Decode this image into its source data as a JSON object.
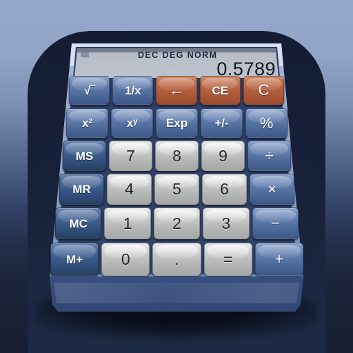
{
  "app": {
    "name": "Calculator",
    "icon_type": "app-icon"
  },
  "colors": {
    "background_top": "#96a8ca",
    "background_bottom": "#171f31",
    "plate": "#17203a",
    "bezel": "#93a6c9",
    "chassis": "#3e5789",
    "key_blue": "#5d79aa",
    "key_blue_dark": "#3d5c8c",
    "key_orange": "#b66243",
    "key_gray": "#c6c7c7",
    "display": "#d9dde1",
    "display_text": "#101722"
  },
  "display": {
    "memory_indicator": "=",
    "mode_indicators": "DEC  DEG    NORM",
    "value": "0.5789"
  },
  "keypad": {
    "rows": [
      {
        "row_index": 0,
        "keys": [
          {
            "name": "sqrt",
            "label": "√‾",
            "style": "blue",
            "glyph_class": ""
          },
          {
            "name": "reciprocal",
            "label": "1/x",
            "style": "blue",
            "glyph_class": ""
          },
          {
            "name": "backspace",
            "label": "←",
            "style": "orange",
            "glyph_class": "big"
          },
          {
            "name": "clear-entry",
            "label": "CE",
            "style": "orange",
            "glyph_class": ""
          },
          {
            "name": "clear",
            "label": "C",
            "style": "orange",
            "glyph_class": "big"
          }
        ]
      },
      {
        "row_index": 1,
        "keys": [
          {
            "name": "square",
            "label": "x²",
            "style": "blue",
            "glyph_class": ""
          },
          {
            "name": "power",
            "label": "xʸ",
            "style": "blue",
            "glyph_class": ""
          },
          {
            "name": "exponent",
            "label": "Exp",
            "style": "blue",
            "glyph_class": ""
          },
          {
            "name": "sign",
            "label": "+/-",
            "style": "blue",
            "glyph_class": ""
          },
          {
            "name": "percent",
            "label": "%",
            "style": "blue",
            "glyph_class": "big"
          }
        ]
      },
      {
        "row_index": 2,
        "keys": [
          {
            "name": "memory-store",
            "label": "MS",
            "style": "blue-dark",
            "glyph_class": ""
          },
          {
            "name": "digit-7",
            "label": "7",
            "style": "gray",
            "glyph_class": "num"
          },
          {
            "name": "digit-8",
            "label": "8",
            "style": "gray",
            "glyph_class": "num"
          },
          {
            "name": "digit-9",
            "label": "9",
            "style": "gray",
            "glyph_class": "num"
          },
          {
            "name": "divide",
            "label": "÷",
            "style": "blue",
            "glyph_class": "big"
          }
        ]
      },
      {
        "row_index": 3,
        "keys": [
          {
            "name": "memory-recall",
            "label": "MR",
            "style": "blue-dark",
            "glyph_class": ""
          },
          {
            "name": "digit-4",
            "label": "4",
            "style": "gray",
            "glyph_class": "num"
          },
          {
            "name": "digit-5",
            "label": "5",
            "style": "gray",
            "glyph_class": "num"
          },
          {
            "name": "digit-6",
            "label": "6",
            "style": "gray",
            "glyph_class": "num"
          },
          {
            "name": "multiply",
            "label": "×",
            "style": "blue",
            "glyph_class": "big"
          }
        ]
      },
      {
        "row_index": 4,
        "keys": [
          {
            "name": "memory-clear",
            "label": "MC",
            "style": "blue-dark",
            "glyph_class": ""
          },
          {
            "name": "digit-1",
            "label": "1",
            "style": "gray",
            "glyph_class": "num"
          },
          {
            "name": "digit-2",
            "label": "2",
            "style": "gray",
            "glyph_class": "num"
          },
          {
            "name": "digit-3",
            "label": "3",
            "style": "gray",
            "glyph_class": "num"
          },
          {
            "name": "subtract",
            "label": "−",
            "style": "blue",
            "glyph_class": "big"
          }
        ]
      },
      {
        "row_index": 5,
        "keys": [
          {
            "name": "memory-add",
            "label": "M+",
            "style": "blue-dark",
            "glyph_class": ""
          },
          {
            "name": "digit-0",
            "label": "0",
            "style": "gray",
            "glyph_class": "num"
          },
          {
            "name": "decimal-point",
            "label": ".",
            "style": "gray",
            "glyph_class": "num"
          },
          {
            "name": "equals",
            "label": "=",
            "style": "gray",
            "glyph_class": "num"
          },
          {
            "name": "add",
            "label": "+",
            "style": "blue",
            "glyph_class": "big"
          }
        ]
      }
    ]
  },
  "geometry": {
    "rows_y": [
      110,
      157,
      204,
      252,
      301,
      352
    ],
    "rows_height": [
      42,
      43,
      44,
      45,
      46,
      48
    ],
    "rows_left": [
      100,
      96,
      91,
      86,
      80,
      73
    ],
    "rows_right": [
      412,
      417,
      422,
      427,
      433,
      440
    ],
    "key_gap": 4
  }
}
